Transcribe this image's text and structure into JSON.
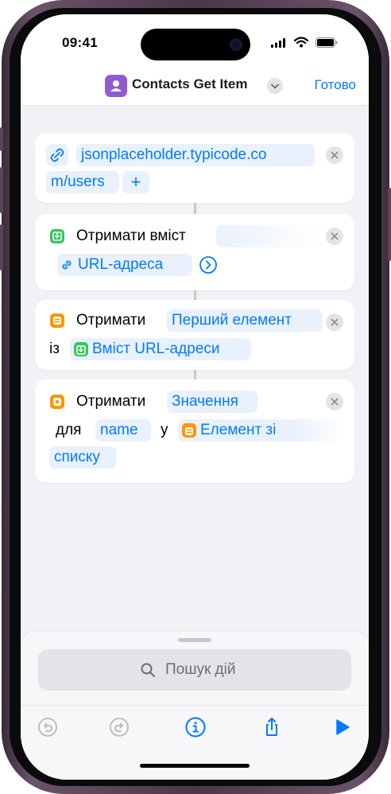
{
  "status_bar": {
    "time": "09:41"
  },
  "nav": {
    "title": "Contacts Get Item",
    "done_label": "Готово"
  },
  "actions": {
    "url": {
      "value_line1": "jsonplaceholder.typicode.co",
      "value_line2": "m/users",
      "add_label": "+"
    },
    "get_contents": {
      "label": "Отримати вміст",
      "input_token": "URL-адреса"
    },
    "get_item": {
      "label": "Отримати",
      "item_token": "Перший елемент",
      "from_label": "із",
      "source_token": "Вміст URL-адреси"
    },
    "get_value": {
      "label": "Отримати",
      "value_token": "Значення",
      "for_label": "для",
      "key_token": "name",
      "in_label": "у",
      "dict_token_line1": "Елемент зі",
      "dict_token_line2": "списку"
    }
  },
  "bottom": {
    "search_placeholder": "Пошук дій"
  },
  "colors": {
    "accent": "#007aff",
    "green_icon": "#34c759",
    "orange_icon": "#ff9500",
    "app_icon": "#8e5bd0"
  }
}
